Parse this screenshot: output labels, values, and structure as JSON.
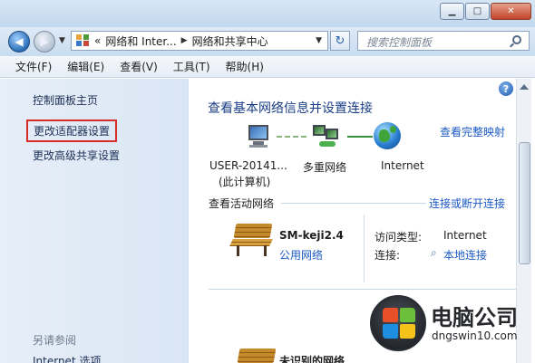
{
  "window": {
    "minimize_glyph": "▁",
    "maximize_glyph": "□",
    "close_glyph": "✕"
  },
  "nav": {
    "back_glyph": "◀",
    "forward_glyph": "▶",
    "recent_glyph": "▼"
  },
  "address": {
    "prefix": "«",
    "segments": [
      "网络和 Inter...",
      "网络和共享中心"
    ],
    "separator": "▶",
    "dropdown_glyph": "▼",
    "refresh_glyph": "↻"
  },
  "search": {
    "placeholder": "搜索控制面板"
  },
  "menu": [
    "文件(F)",
    "编辑(E)",
    "查看(V)",
    "工具(T)",
    "帮助(H)"
  ],
  "sidebar": {
    "items": [
      {
        "label": "控制面板主页"
      },
      {
        "label": "更改适配器设置",
        "highlighted": true
      },
      {
        "label": "更改高级共享设置"
      }
    ],
    "see_also_heading": "另请参阅",
    "see_also_items": [
      {
        "label": "Internet 选项"
      }
    ]
  },
  "main": {
    "help_glyph": "?",
    "heading": "查看基本网络信息并设置连接",
    "view_full_map": "查看完整映射",
    "map": {
      "computer_name": "USER-20141...",
      "computer_sub": "(此计算机)",
      "multi_network": "多重网络",
      "internet": "Internet"
    },
    "active_networks_label": "查看活动网络",
    "connect_disconnect": "连接或断开连接",
    "network1": {
      "name": "SM-keji2.4",
      "type_link": "公用网络",
      "access_type_label": "访问类型:",
      "access_type_value": "Internet",
      "connection_label": "连接:",
      "connection_value": "本地连接"
    },
    "network2": {
      "name": "未识别的网络"
    }
  },
  "watermark": {
    "title": "电脑公司",
    "url": "dngswin10.com"
  },
  "colors": {
    "link": "#1c5ac4",
    "heading": "#1a3e86",
    "highlight_border": "#d92c27",
    "sidebar_bg": "#dfe9f5"
  }
}
